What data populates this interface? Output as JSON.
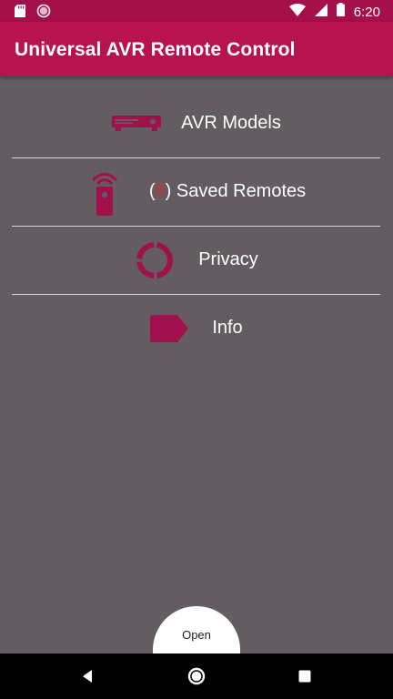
{
  "status_bar": {
    "time": "6:20",
    "icons": [
      "sd-card-icon",
      "notification-dot-icon",
      "wifi-icon",
      "signal-icon",
      "battery-icon"
    ]
  },
  "app_bar": {
    "title": "Universal AVR Remote Control"
  },
  "menu": {
    "items": [
      {
        "label": "AVR Models",
        "icon": "avr-receiver-icon"
      },
      {
        "count_open": "(",
        "count": "0",
        "count_close": ")",
        "label": " Saved Remotes",
        "icon": "remote-control-icon"
      },
      {
        "label": "Privacy",
        "icon": "circle-segments-icon"
      },
      {
        "label": "Info",
        "icon": "tag-label-icon"
      }
    ]
  },
  "open_button": {
    "label": "Open"
  },
  "nav": {
    "back": "back-icon",
    "home": "home-icon",
    "recents": "recents-icon"
  },
  "colors": {
    "accent": "#b7134f",
    "status_bar": "#a5104a",
    "background": "#635d62",
    "icon": "#a0104a",
    "count": "#e0262b"
  }
}
